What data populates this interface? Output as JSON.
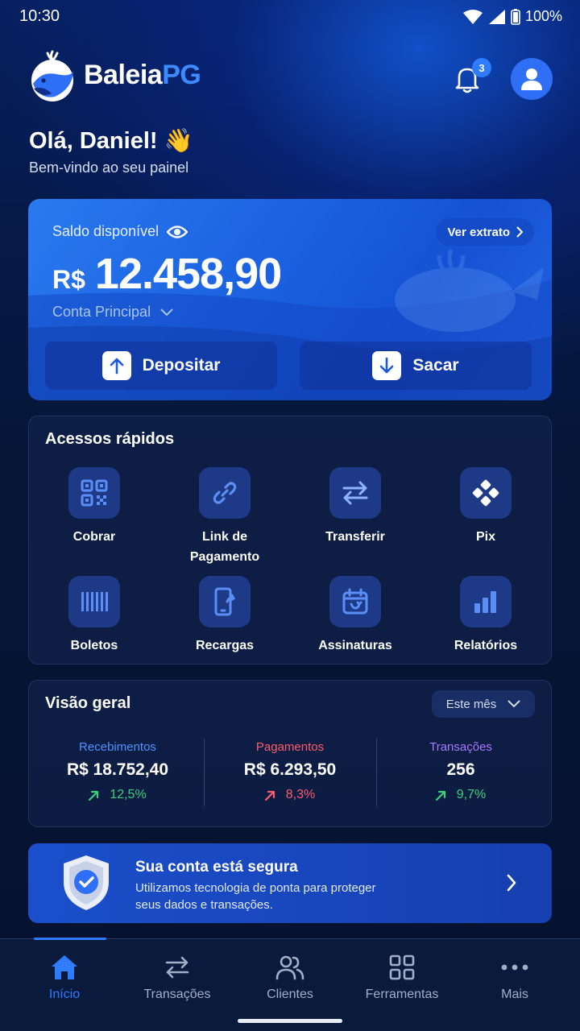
{
  "status_bar": {
    "time": "10:30",
    "battery": "100%"
  },
  "header": {
    "brand_main": "Baleia",
    "brand_accent": "PG",
    "notification_count": "3"
  },
  "greeting": {
    "title": "Olá, Daniel! 👋",
    "subtitle": "Bem-vindo ao seu painel"
  },
  "balance": {
    "label": "Saldo disponível",
    "statement_button": "Ver extrato",
    "currency": "R$",
    "amount": "12.458,90",
    "account": "Conta Principal",
    "deposit_label": "Depositar",
    "withdraw_label": "Sacar"
  },
  "quick_access": {
    "title": "Acessos rápidos",
    "items": [
      {
        "label": "Cobrar",
        "icon": "qr-code-icon"
      },
      {
        "label": "Link de Pagamento",
        "icon": "link-icon"
      },
      {
        "label": "Transferir",
        "icon": "transfer-icon"
      },
      {
        "label": "Pix",
        "icon": "pix-icon"
      },
      {
        "label": "Boletos",
        "icon": "barcode-icon"
      },
      {
        "label": "Recargas",
        "icon": "phone-recharge-icon"
      },
      {
        "label": "Assinaturas",
        "icon": "calendar-icon"
      },
      {
        "label": "Relatórios",
        "icon": "bar-chart-icon"
      }
    ]
  },
  "overview": {
    "title": "Visão geral",
    "period": "Este mês",
    "stats": [
      {
        "title": "Recebimentos",
        "value": "R$ 18.752,40",
        "delta": "12,5%",
        "title_color": "#4f93ff",
        "delta_color": "#3ccf7a"
      },
      {
        "title": "Pagamentos",
        "value": "R$ 6.293,50",
        "delta": "8,3%",
        "title_color": "#ff5b6e",
        "delta_color": "#ff5b6e"
      },
      {
        "title": "Transações",
        "value": "256",
        "delta": "9,7%",
        "title_color": "#a979ff",
        "delta_color": "#3ccf7a"
      }
    ]
  },
  "security": {
    "title": "Sua conta está segura",
    "description": "Utilizamos tecnologia de ponta para proteger seus dados e transações."
  },
  "bottom_nav": {
    "items": [
      {
        "label": "Início",
        "icon": "home-icon",
        "active": true
      },
      {
        "label": "Transações",
        "icon": "swap-icon",
        "active": false
      },
      {
        "label": "Clientes",
        "icon": "users-icon",
        "active": false
      },
      {
        "label": "Ferramentas",
        "icon": "grid-icon",
        "active": false
      },
      {
        "label": "Mais",
        "icon": "more-icon",
        "active": false
      }
    ]
  },
  "colors": {
    "accent": "#2f7cff",
    "background": "#06122e",
    "card": "#1c63e2"
  }
}
